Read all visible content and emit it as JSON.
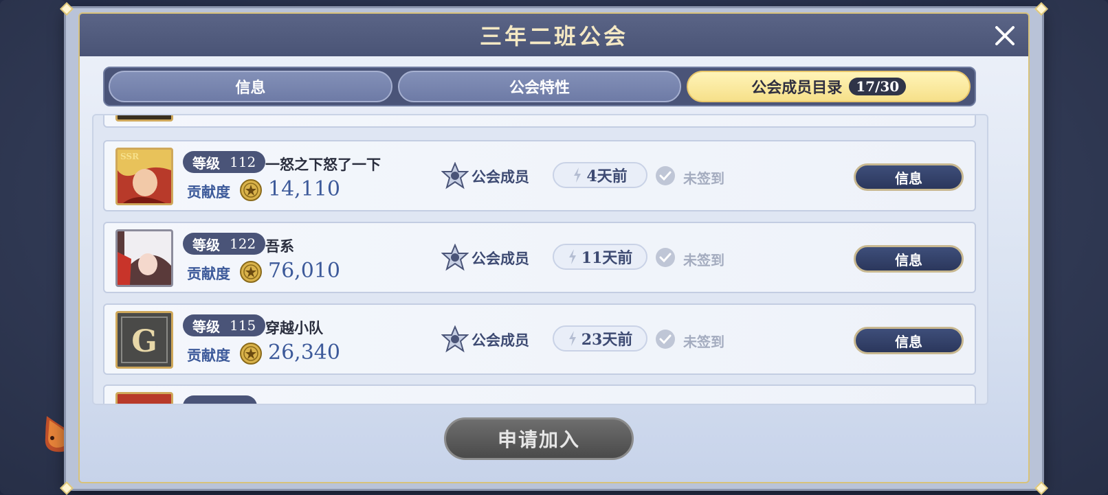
{
  "dialog": {
    "title": "三年二班公会"
  },
  "tabs": [
    {
      "label": "信息",
      "active": false
    },
    {
      "label": "公会特性",
      "active": false
    },
    {
      "label": "公会成员目录",
      "active": true,
      "badge": "17/30"
    }
  ],
  "labels": {
    "level": "等级",
    "contribution": "贡献度",
    "info_button": "信息"
  },
  "members": [
    {
      "level": "112",
      "name": "一怒之下怒了一下",
      "contribution": "14,110",
      "role": "公会成员",
      "last_online": "4天前",
      "signin": "未签到",
      "avatar": "red-haired-elf-ssr"
    },
    {
      "level": "122",
      "name": "吾系",
      "contribution": "76,010",
      "role": "公会成员",
      "last_online": "11天前",
      "signin": "未签到",
      "avatar": "white-haired-demon"
    },
    {
      "level": "115",
      "name": "穿越小队",
      "contribution": "26,340",
      "role": "公会成员",
      "last_online": "23天前",
      "signin": "未签到",
      "avatar": "guild-g-emblem"
    }
  ],
  "footer": {
    "join_button": "申请加入"
  },
  "colors": {
    "accent_gold": "#f6e08a",
    "navy": "#2b375c",
    "contribution_blue": "#3d5a9a"
  }
}
